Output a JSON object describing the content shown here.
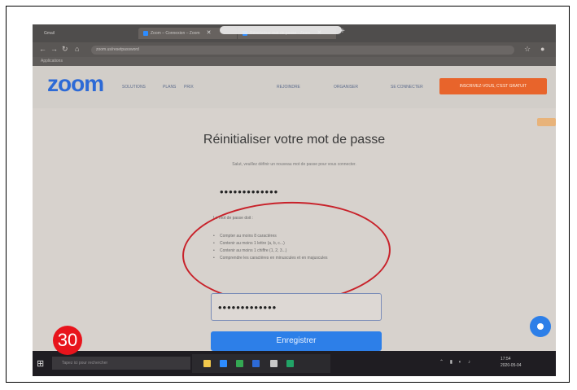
{
  "browser": {
    "tabs": [
      "Gmail",
      "Zoom – Connexion – Zoom",
      "Réinitialiser mot de passe - Zoom"
    ],
    "url": "zoom.us/resetpassword",
    "bookmarks": "Applications"
  },
  "zoom_header": {
    "logo": "zoom",
    "nav_left": [
      "SOLUTIONS",
      "PLANS",
      "PRIX"
    ],
    "nav_right": [
      "REJOINDRE",
      "ORGANISER",
      "SE CONNECTER"
    ],
    "signup_button": "INSCRIVEZ-VOUS, C'EST GRATUIT"
  },
  "reset": {
    "title": "Réinitialiser votre mot de passe",
    "subtitle": "Salut, veuillez définir un nouveau mot de passe pour vous connecter.",
    "password_value": "•••••••••••••",
    "rules_title": "Le mot de passe doit :",
    "rules": [
      "Compter au moins 8 caractères",
      "Contenir au moins 1 lettre (a, b, c...)",
      "Contenir au moins 1 chiffre (1, 2, 3...)",
      "Comprendre les caractères en minuscules et en majuscules"
    ],
    "confirm_value": "•••••••••••••",
    "save_button": "Enregistrer"
  },
  "taskbar": {
    "search_placeholder": "Tapez ici pour rechercher",
    "clock_time": "17:54",
    "clock_date": "2020-05-04"
  },
  "badge": "30",
  "colors": {
    "zoom_blue": "#2d6ad6",
    "accent_orange": "#e8642b",
    "annotation_red": "#c8222a",
    "badge_red": "#e8141c"
  }
}
